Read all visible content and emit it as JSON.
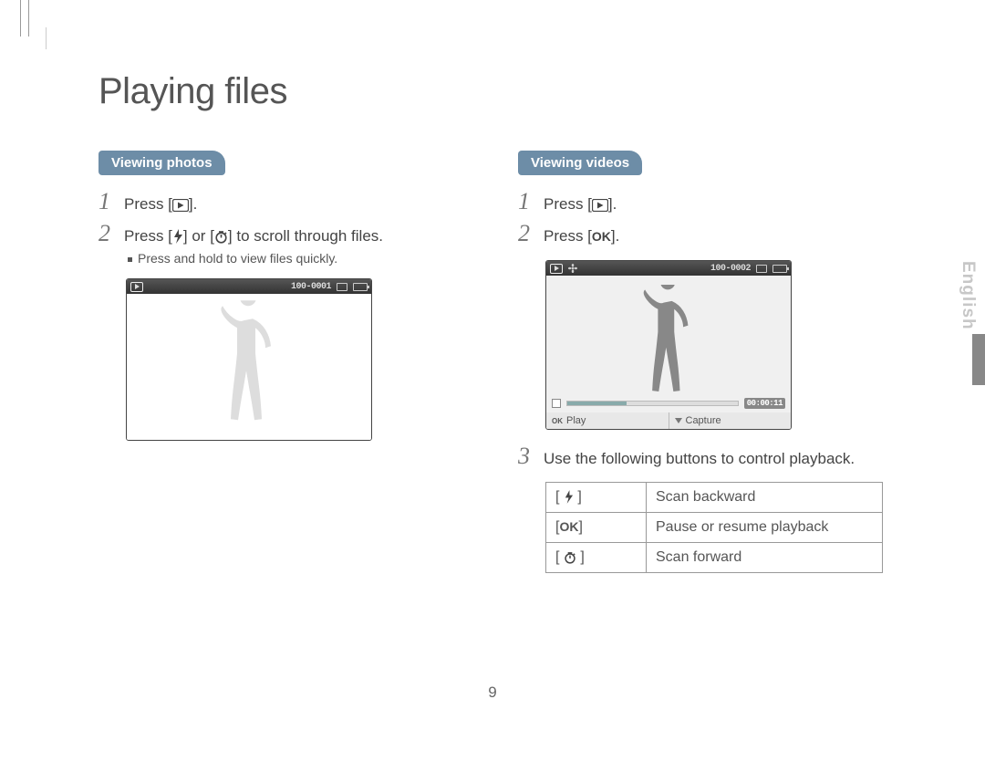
{
  "title": "Playing files",
  "language_tab": "English",
  "page_number": "9",
  "photos": {
    "heading": "Viewing photos",
    "step1": {
      "pre": "Press [",
      "post": "]."
    },
    "step2": {
      "pre": "Press [",
      "mid": "] or [",
      "post": "] to scroll through files."
    },
    "note": "Press and hold to view files quickly.",
    "file_counter": "100-0001"
  },
  "videos": {
    "heading": "Viewing videos",
    "step1": {
      "pre": "Press [",
      "post": "]."
    },
    "step2": {
      "pre": "Press [",
      "post": "]."
    },
    "step3": "Use the following buttons to control playback.",
    "file_counter": "100-0002",
    "timecode": "00:00:11",
    "bottom_left": "Play",
    "bottom_right": "Capture"
  },
  "controls": {
    "r1": "Scan backward",
    "r2": "Pause or resume playback",
    "r3": "Scan forward"
  }
}
